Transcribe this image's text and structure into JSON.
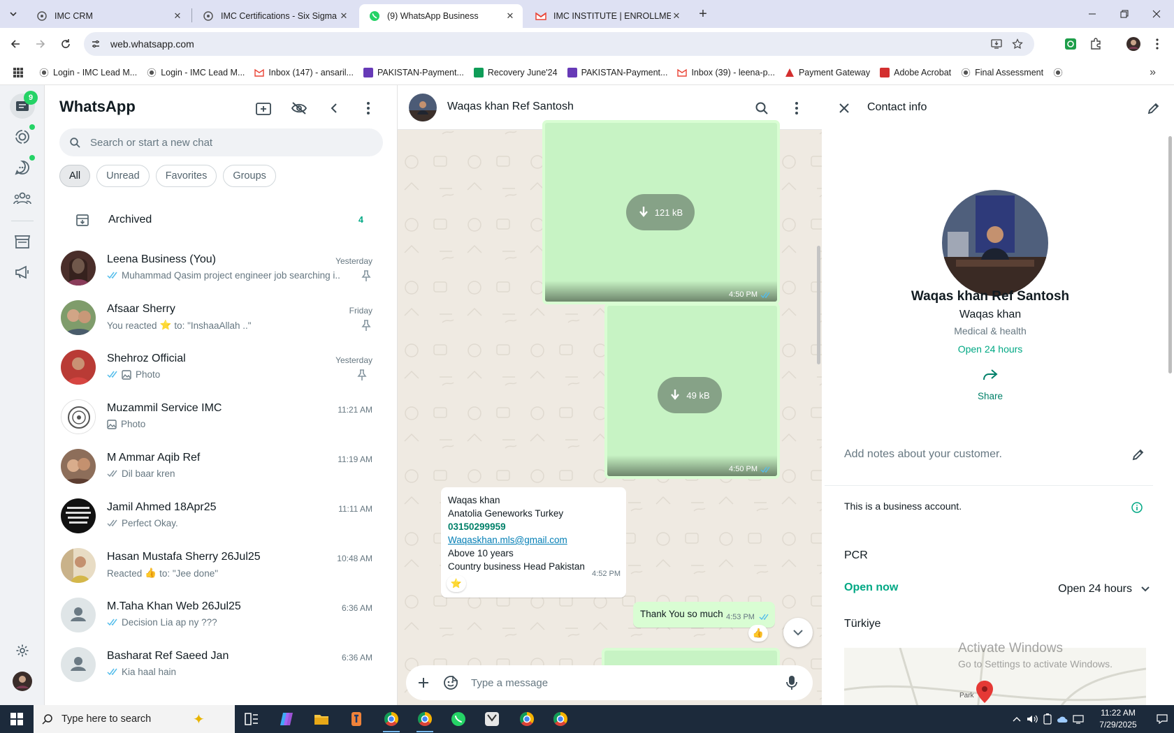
{
  "browser": {
    "tabs": [
      {
        "title": "IMC CRM",
        "active": false
      },
      {
        "title": "IMC Certifications - Six Sigma G",
        "active": false
      },
      {
        "title": "(9) WhatsApp Business",
        "active": true
      },
      {
        "title": "IMC INSTITUTE | ENROLLMENT",
        "active": false
      }
    ],
    "url": "web.whatsapp.com",
    "bookmarks": [
      {
        "label": "Login - IMC Lead M...",
        "icon": "imc-icon"
      },
      {
        "label": "Login - IMC Lead M...",
        "icon": "imc-icon"
      },
      {
        "label": "Inbox (147) - ansaril...",
        "icon": "gmail-icon"
      },
      {
        "label": "PAKISTAN-Payment...",
        "icon": "forms-icon"
      },
      {
        "label": "Recovery June'24",
        "icon": "sheets-icon"
      },
      {
        "label": "PAKISTAN-Payment...",
        "icon": "forms-icon"
      },
      {
        "label": "Inbox (39) - leena-p...",
        "icon": "gmail-icon"
      },
      {
        "label": "Payment Gateway",
        "icon": "gateway-icon"
      },
      {
        "label": "Adobe Acrobat",
        "icon": "acrobat-icon"
      },
      {
        "label": "Final Assessment",
        "icon": "imc-icon"
      }
    ]
  },
  "rail": {
    "badge": "9"
  },
  "chatlist": {
    "title": "WhatsApp",
    "search_placeholder": "Search or start a new chat",
    "filters": [
      "All",
      "Unread",
      "Favorites",
      "Groups"
    ],
    "archived_label": "Archived",
    "archived_count": "4",
    "chats": [
      {
        "name": "Leena Business (You)",
        "time": "Yesterday",
        "preview": "Muhammad Qasim project engineer job searching i...",
        "tick": "blue",
        "pinned": true,
        "avatar": "photo"
      },
      {
        "name": "Afsaar Sherry",
        "time": "Friday",
        "preview_pre": "You reacted",
        "preview_emoji": "⭐",
        "preview_post": "to: \"InshaaAllah ..\"",
        "tick": "none",
        "pinned": true,
        "avatar": "photo"
      },
      {
        "name": "Shehroz Official",
        "time": "Yesterday",
        "preview": "Photo",
        "tick": "blue",
        "photo_icon": true,
        "pinned": true,
        "avatar": "photo"
      },
      {
        "name": "Muzammil Service IMC",
        "time": "11:21 AM",
        "preview": "Photo",
        "tick": "none",
        "photo_icon": true,
        "pinned": false,
        "avatar": "logo"
      },
      {
        "name": "M Ammar Aqib Ref",
        "time": "11:19 AM",
        "preview": "Dil baar kren",
        "tick": "gray",
        "pinned": false,
        "avatar": "photo"
      },
      {
        "name": "Jamil Ahmed 18Apr25",
        "time": "11:11 AM",
        "preview": "Perfect Okay.",
        "tick": "gray",
        "pinned": false,
        "avatar": "text"
      },
      {
        "name": "Hasan Mustafa Sherry 26Jul25",
        "time": "10:48 AM",
        "preview_pre": "Reacted",
        "preview_emoji": "👍",
        "preview_post": "to: \"Jee done\"",
        "tick": "none",
        "pinned": false,
        "avatar": "photo"
      },
      {
        "name": "M.Taha Khan Web 26Jul25",
        "time": "6:36 AM",
        "preview": "Decision Lia ap ny ???",
        "tick": "blue",
        "pinned": false,
        "avatar": "default"
      },
      {
        "name": "Basharat Ref Saeed Jan",
        "time": "6:36 AM",
        "preview": "Kia haal hain",
        "tick": "blue",
        "pinned": false,
        "avatar": "default"
      }
    ]
  },
  "chat": {
    "name": "Waqas khan Ref Santosh",
    "messages": {
      "img1_size": "121 kB",
      "img1_time": "4:50 PM",
      "img2_size": "49 kB",
      "img2_time": "4:50 PM",
      "card_lines": [
        "Waqas khan",
        "Anatolia Geneworks Turkey"
      ],
      "card_phone": "03150299959",
      "card_email": "Waqaskhan.mls@gmail.com",
      "card_lines2": [
        "Above 10 years",
        "Country business Head Pakistan"
      ],
      "card_time": "4:52 PM",
      "card_reaction": "⭐",
      "out_text": "Thank You so much",
      "out_time": "4:53 PM",
      "out_reaction": "👍"
    },
    "composer_placeholder": "Type a message"
  },
  "contact": {
    "header": "Contact info",
    "name": "Waqas khan Ref Santosh",
    "subname": "Waqas khan",
    "category": "Medical & health",
    "hours_status": "Open 24 hours",
    "share_label": "Share",
    "notes_placeholder": "Add notes about your customer.",
    "business_note": "This is a business account.",
    "address_line": "PCR",
    "open_now": "Open now",
    "hours_detail": "Open 24 hours",
    "country": "Türkiye",
    "map_label": "Park"
  },
  "watermark": {
    "line1": "Activate Windows",
    "line2": "Go to Settings to activate Windows."
  },
  "taskbar": {
    "search_placeholder": "Type here to search",
    "time": "11:22 AM",
    "date": "7/29/2025"
  },
  "colors": {
    "wa_green": "#00a884",
    "accent_blue": "#53bdeb",
    "outgoing_bubble": "#d9fdd3",
    "chat_bg": "#efeae2",
    "taskbar": "#1c2a3b"
  }
}
